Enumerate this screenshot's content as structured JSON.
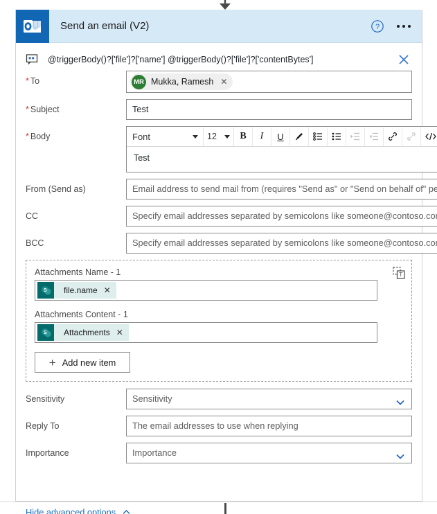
{
  "flow": {
    "connector_top_icon": "arrow-down-icon",
    "connector_bottom_icon": "vertical-line"
  },
  "header": {
    "app_icon": "outlook-icon",
    "title": "Send an email (V2)",
    "help_icon": "help-circle-icon",
    "more_icon": "ellipsis-icon",
    "background": "#d6e9f7",
    "icon_tile_color": "#1267b4"
  },
  "expression_bar": {
    "icon": "comment-icon",
    "text": "@triggerBody()?['file']?['name'] @triggerBody()?['file']?['contentBytes']",
    "close_icon": "close-icon",
    "close_color": "#3b78d8"
  },
  "fields": {
    "to": {
      "label": "To",
      "required": true,
      "chip": {
        "initials": "MR",
        "name": "Mukka, Ramesh",
        "avatar_color": "#2d7d32",
        "remove_icon": "close-icon"
      }
    },
    "subject": {
      "label": "Subject",
      "required": true,
      "value": "Test"
    },
    "body": {
      "label": "Body",
      "required": true,
      "value": "Test",
      "toolbar": {
        "font_name": "Font",
        "font_size": "12",
        "buttons": [
          {
            "name": "bold-icon",
            "glyph": "B",
            "disabled": false
          },
          {
            "name": "italic-icon",
            "glyph": "I",
            "disabled": false
          },
          {
            "name": "underline-icon",
            "glyph": "U",
            "disabled": false
          },
          {
            "name": "text-color-icon",
            "glyph": "pen",
            "disabled": false
          },
          {
            "name": "bulleted-list-icon",
            "glyph": "bullets",
            "disabled": false
          },
          {
            "name": "numbered-list-icon",
            "glyph": "numbers",
            "disabled": false
          },
          {
            "name": "indent-icon",
            "glyph": "indent",
            "disabled": true
          },
          {
            "name": "outdent-icon",
            "glyph": "outdent",
            "disabled": true
          },
          {
            "name": "link-icon",
            "glyph": "link",
            "disabled": false
          },
          {
            "name": "unlink-icon",
            "glyph": "unlink",
            "disabled": true
          },
          {
            "name": "code-view-icon",
            "glyph": "</>",
            "disabled": false
          }
        ]
      }
    },
    "from": {
      "label": "From (Send as)",
      "required": false,
      "placeholder": "Email address to send mail from (requires \"Send as\" or \"Send on behalf of\" permissions)"
    },
    "cc": {
      "label": "CC",
      "required": false,
      "placeholder": "Specify email addresses separated by semicolons like someone@contoso.com"
    },
    "bcc": {
      "label": "BCC",
      "required": false,
      "placeholder": "Specify email addresses separated by semicolons like someone@contoso.com"
    },
    "sensitivity": {
      "label": "Sensitivity",
      "required": false,
      "placeholder": "Sensitivity",
      "caret_icon": "chevron-down-icon"
    },
    "reply_to": {
      "label": "Reply To",
      "required": false,
      "placeholder": "The email addresses to use when replying"
    },
    "importance": {
      "label": "Importance",
      "required": false,
      "placeholder": "Importance",
      "caret_icon": "chevron-down-icon"
    }
  },
  "attachments": {
    "delete_icon": "delete-item-icon",
    "name_label": "Attachments Name - 1",
    "name_token": {
      "icon": "sharepoint-icon",
      "text": "file.name",
      "remove_icon": "close-icon",
      "icon_color": "#046b6b",
      "chip_color": "#ddeeec"
    },
    "content_label": "Attachments Content - 1",
    "content_token": {
      "icon": "sharepoint-icon",
      "text": "Attachments",
      "remove_icon": "close-icon",
      "icon_color": "#046b6b",
      "chip_color": "#ddeeec"
    },
    "add_button": {
      "plus_icon": "plus-icon",
      "label": "Add new item"
    }
  },
  "advanced": {
    "label": "Hide advanced options",
    "chevron_icon": "chevron-up-icon",
    "link_color": "#1b6ec2"
  }
}
